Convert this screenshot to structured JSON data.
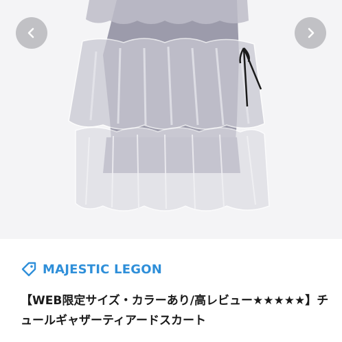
{
  "product": {
    "brand": "MAJESTIC LEGON",
    "title": "【WEB限定サイズ・カラーあり/高レビュー★★★★★】チュールギャザーティアードスカート",
    "image_alt": "Gray tiered tulle skirt with black ribbon"
  },
  "gallery": {
    "prev_label": "‹",
    "next_label": "›"
  },
  "colors": {
    "brand_blue": "#2f8fd9",
    "skirt_gray": "#9c9bab",
    "button_gray": "#b9b9bd"
  },
  "icons": {
    "prev": "chevron-left-icon",
    "next": "chevron-right-icon",
    "brand": "tag-icon"
  }
}
